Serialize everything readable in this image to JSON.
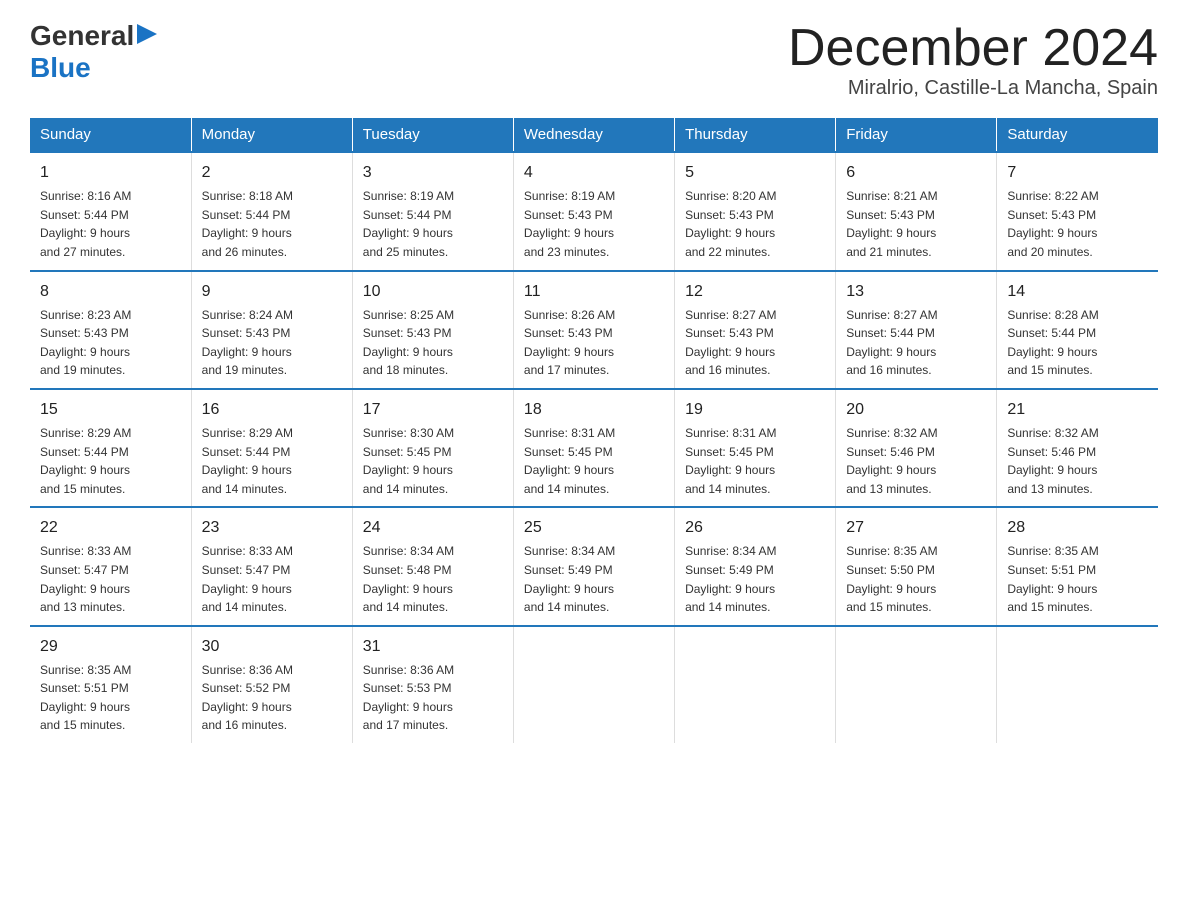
{
  "header": {
    "logo_general": "General",
    "logo_blue": "Blue",
    "month_title": "December 2024",
    "location": "Miralrio, Castille-La Mancha, Spain"
  },
  "weekdays": [
    "Sunday",
    "Monday",
    "Tuesday",
    "Wednesday",
    "Thursday",
    "Friday",
    "Saturday"
  ],
  "weeks": [
    [
      {
        "day": "1",
        "sunrise": "8:16 AM",
        "sunset": "5:44 PM",
        "daylight": "9 hours and 27 minutes."
      },
      {
        "day": "2",
        "sunrise": "8:18 AM",
        "sunset": "5:44 PM",
        "daylight": "9 hours and 26 minutes."
      },
      {
        "day": "3",
        "sunrise": "8:19 AM",
        "sunset": "5:44 PM",
        "daylight": "9 hours and 25 minutes."
      },
      {
        "day": "4",
        "sunrise": "8:19 AM",
        "sunset": "5:43 PM",
        "daylight": "9 hours and 23 minutes."
      },
      {
        "day": "5",
        "sunrise": "8:20 AM",
        "sunset": "5:43 PM",
        "daylight": "9 hours and 22 minutes."
      },
      {
        "day": "6",
        "sunrise": "8:21 AM",
        "sunset": "5:43 PM",
        "daylight": "9 hours and 21 minutes."
      },
      {
        "day": "7",
        "sunrise": "8:22 AM",
        "sunset": "5:43 PM",
        "daylight": "9 hours and 20 minutes."
      }
    ],
    [
      {
        "day": "8",
        "sunrise": "8:23 AM",
        "sunset": "5:43 PM",
        "daylight": "9 hours and 19 minutes."
      },
      {
        "day": "9",
        "sunrise": "8:24 AM",
        "sunset": "5:43 PM",
        "daylight": "9 hours and 19 minutes."
      },
      {
        "day": "10",
        "sunrise": "8:25 AM",
        "sunset": "5:43 PM",
        "daylight": "9 hours and 18 minutes."
      },
      {
        "day": "11",
        "sunrise": "8:26 AM",
        "sunset": "5:43 PM",
        "daylight": "9 hours and 17 minutes."
      },
      {
        "day": "12",
        "sunrise": "8:27 AM",
        "sunset": "5:43 PM",
        "daylight": "9 hours and 16 minutes."
      },
      {
        "day": "13",
        "sunrise": "8:27 AM",
        "sunset": "5:44 PM",
        "daylight": "9 hours and 16 minutes."
      },
      {
        "day": "14",
        "sunrise": "8:28 AM",
        "sunset": "5:44 PM",
        "daylight": "9 hours and 15 minutes."
      }
    ],
    [
      {
        "day": "15",
        "sunrise": "8:29 AM",
        "sunset": "5:44 PM",
        "daylight": "9 hours and 15 minutes."
      },
      {
        "day": "16",
        "sunrise": "8:29 AM",
        "sunset": "5:44 PM",
        "daylight": "9 hours and 14 minutes."
      },
      {
        "day": "17",
        "sunrise": "8:30 AM",
        "sunset": "5:45 PM",
        "daylight": "9 hours and 14 minutes."
      },
      {
        "day": "18",
        "sunrise": "8:31 AM",
        "sunset": "5:45 PM",
        "daylight": "9 hours and 14 minutes."
      },
      {
        "day": "19",
        "sunrise": "8:31 AM",
        "sunset": "5:45 PM",
        "daylight": "9 hours and 14 minutes."
      },
      {
        "day": "20",
        "sunrise": "8:32 AM",
        "sunset": "5:46 PM",
        "daylight": "9 hours and 13 minutes."
      },
      {
        "day": "21",
        "sunrise": "8:32 AM",
        "sunset": "5:46 PM",
        "daylight": "9 hours and 13 minutes."
      }
    ],
    [
      {
        "day": "22",
        "sunrise": "8:33 AM",
        "sunset": "5:47 PM",
        "daylight": "9 hours and 13 minutes."
      },
      {
        "day": "23",
        "sunrise": "8:33 AM",
        "sunset": "5:47 PM",
        "daylight": "9 hours and 14 minutes."
      },
      {
        "day": "24",
        "sunrise": "8:34 AM",
        "sunset": "5:48 PM",
        "daylight": "9 hours and 14 minutes."
      },
      {
        "day": "25",
        "sunrise": "8:34 AM",
        "sunset": "5:49 PM",
        "daylight": "9 hours and 14 minutes."
      },
      {
        "day": "26",
        "sunrise": "8:34 AM",
        "sunset": "5:49 PM",
        "daylight": "9 hours and 14 minutes."
      },
      {
        "day": "27",
        "sunrise": "8:35 AM",
        "sunset": "5:50 PM",
        "daylight": "9 hours and 15 minutes."
      },
      {
        "day": "28",
        "sunrise": "8:35 AM",
        "sunset": "5:51 PM",
        "daylight": "9 hours and 15 minutes."
      }
    ],
    [
      {
        "day": "29",
        "sunrise": "8:35 AM",
        "sunset": "5:51 PM",
        "daylight": "9 hours and 15 minutes."
      },
      {
        "day": "30",
        "sunrise": "8:36 AM",
        "sunset": "5:52 PM",
        "daylight": "9 hours and 16 minutes."
      },
      {
        "day": "31",
        "sunrise": "8:36 AM",
        "sunset": "5:53 PM",
        "daylight": "9 hours and 17 minutes."
      },
      null,
      null,
      null,
      null
    ]
  ],
  "labels": {
    "sunrise": "Sunrise:",
    "sunset": "Sunset:",
    "daylight": "Daylight:"
  }
}
